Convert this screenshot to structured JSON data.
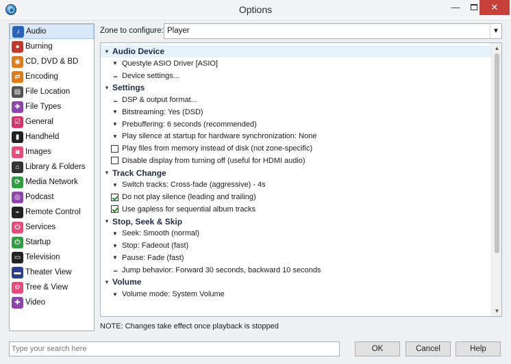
{
  "window": {
    "title": "Options",
    "minimize": "—",
    "close": "✕"
  },
  "sidebar": {
    "items": [
      {
        "label": "Audio",
        "icon": "music-note-icon",
        "glyph": "♪",
        "color": "#2b63b8",
        "selected": true
      },
      {
        "label": "Burning",
        "icon": "burn-disc-icon",
        "glyph": "●",
        "color": "#c0392b"
      },
      {
        "label": "CD, DVD & BD",
        "icon": "disc-icon",
        "glyph": "◉",
        "color": "#e07b18"
      },
      {
        "label": "Encoding",
        "icon": "encoding-icon",
        "glyph": "⇄",
        "color": "#e07b18"
      },
      {
        "label": "File Location",
        "icon": "file-location-icon",
        "glyph": "▤",
        "color": "#555555"
      },
      {
        "label": "File Types",
        "icon": "puzzle-icon",
        "glyph": "✚",
        "color": "#8e44ad"
      },
      {
        "label": "General",
        "icon": "checkbox-icon",
        "glyph": "☑",
        "color": "#d6336c"
      },
      {
        "label": "Handheld",
        "icon": "handheld-icon",
        "glyph": "▮",
        "color": "#222222"
      },
      {
        "label": "Images",
        "icon": "camera-icon",
        "glyph": "◙",
        "color": "#e84a7a"
      },
      {
        "label": "Library & Folders",
        "icon": "home-icon",
        "glyph": "⌂",
        "color": "#333333"
      },
      {
        "label": "Media Network",
        "icon": "network-icon",
        "glyph": "⟳",
        "color": "#2e9e3e"
      },
      {
        "label": "Podcast",
        "icon": "podcast-icon",
        "glyph": "◎",
        "color": "#8e44ad"
      },
      {
        "label": "Remote Control",
        "icon": "remote-icon",
        "glyph": "⌁",
        "color": "#222222"
      },
      {
        "label": "Services",
        "icon": "plug-icon",
        "glyph": "⏻",
        "color": "#e84a7a"
      },
      {
        "label": "Startup",
        "icon": "power-icon",
        "glyph": "⏻",
        "color": "#2e9e3e"
      },
      {
        "label": "Television",
        "icon": "television-icon",
        "glyph": "▭",
        "color": "#222222"
      },
      {
        "label": "Theater View",
        "icon": "theater-view-icon",
        "glyph": "▬",
        "color": "#2b3f8c"
      },
      {
        "label": "Tree & View",
        "icon": "tree-view-icon",
        "glyph": "⚙",
        "color": "#e84a7a"
      },
      {
        "label": "Video",
        "icon": "video-icon",
        "glyph": "✚",
        "color": "#8e44ad"
      }
    ]
  },
  "zone": {
    "label": "Zone to configure:",
    "value": "Player"
  },
  "tree": {
    "sections": [
      {
        "header": "Audio Device",
        "selected": true,
        "items": [
          {
            "type": "expand",
            "label": "Questyle ASIO Driver [ASIO]"
          },
          {
            "type": "action",
            "label": "Device settings..."
          }
        ]
      },
      {
        "header": "Settings",
        "items": [
          {
            "type": "action",
            "label": "DSP & output format..."
          },
          {
            "type": "expand",
            "label": "Bitstreaming: Yes (DSD)"
          },
          {
            "type": "expand",
            "label": "Prebuffering: 6 seconds (recommended)"
          },
          {
            "type": "expand",
            "label": "Play silence at startup for hardware synchronization: None"
          },
          {
            "type": "check",
            "checked": false,
            "label": "Play files from memory instead of disk (not zone-specific)"
          },
          {
            "type": "check",
            "checked": false,
            "label": "Disable display from turning off (useful for HDMI audio)"
          }
        ]
      },
      {
        "header": "Track Change",
        "items": [
          {
            "type": "expand",
            "label": "Switch tracks: Cross-fade (aggressive) - 4s"
          },
          {
            "type": "check",
            "checked": true,
            "label": "Do not play silence (leading and trailing)"
          },
          {
            "type": "check",
            "checked": true,
            "label": "Use gapless for sequential album tracks"
          }
        ]
      },
      {
        "header": "Stop, Seek & Skip",
        "items": [
          {
            "type": "expand",
            "label": "Seek: Smooth (normal)"
          },
          {
            "type": "expand",
            "label": "Stop: Fadeout (fast)"
          },
          {
            "type": "expand",
            "label": "Pause: Fade (fast)"
          },
          {
            "type": "action",
            "label": "Jump behavior: Forward 30 seconds, backward 10 seconds"
          }
        ]
      },
      {
        "header": "Volume",
        "items": [
          {
            "type": "expand",
            "label": "Volume mode: System Volume"
          }
        ]
      }
    ]
  },
  "note": "NOTE: Changes take effect once playback is stopped",
  "search": {
    "placeholder": "Type your search here"
  },
  "buttons": {
    "ok": "OK",
    "cancel": "Cancel",
    "help": "Help"
  }
}
